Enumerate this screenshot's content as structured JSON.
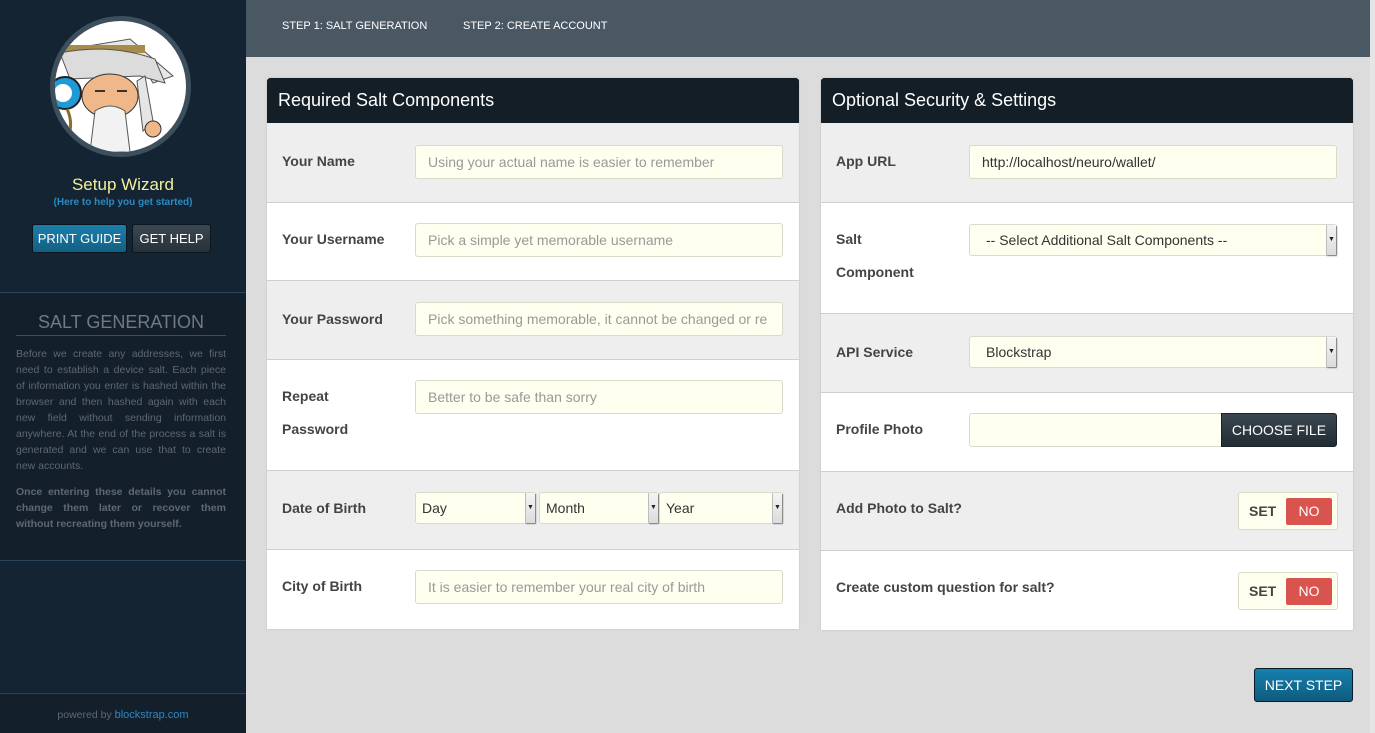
{
  "sidebar": {
    "avatar_alt": "wizard-mascot",
    "title": "Setup Wizard",
    "subtitle": "(Here to help you get started)",
    "print_button": "PRINT GUIDE",
    "help_button": "GET HELP",
    "section_heading": "SALT GENERATION",
    "section_text": "Before we create any addresses, we first need to establish a device salt. Each piece of information you enter is hashed within the browser and then hashed again with each new field without sending information anywhere. At the end of the process a salt is generated and we can use that to create new accounts.",
    "section_warning": "Once entering these details you cannot change them later or recover them without recreating them yourself.",
    "footer_prefix": "powered by ",
    "footer_link": "blockstrap.com"
  },
  "nav": {
    "steps": [
      {
        "label": "STEP 1: SALT GENERATION"
      },
      {
        "label": "STEP 2: CREATE ACCOUNT"
      }
    ]
  },
  "required": {
    "title": "Required Salt Components",
    "name": {
      "label": "Your Name",
      "placeholder": "Using your actual name is easier to remember"
    },
    "username": {
      "label": "Your Username",
      "placeholder": "Pick a simple yet memorable username"
    },
    "password": {
      "label": "Your Password",
      "placeholder": "Pick something memorable, it cannot be changed or re"
    },
    "repeat": {
      "label_line1": "Repeat",
      "label_line2": "Password",
      "placeholder": "Better to be safe than sorry"
    },
    "dob": {
      "label": "Date of Birth",
      "day": "Day",
      "month": "Month",
      "year": "Year"
    },
    "city": {
      "label": "City of Birth",
      "placeholder": "It is easier to remember your real city of birth"
    }
  },
  "optional": {
    "title": "Optional Security & Settings",
    "app_url": {
      "label": "App URL",
      "value": "http://localhost/neuro/wallet/"
    },
    "salt_component": {
      "label_line1": "Salt",
      "label_line2": "Component",
      "selected": "-- Select Additional Salt Components --"
    },
    "api_service": {
      "label": "API Service",
      "selected": "Blockstrap"
    },
    "profile_photo": {
      "label": "Profile Photo",
      "button": "CHOOSE FILE"
    },
    "add_photo": {
      "label": "Add Photo to Salt?",
      "set": "SET",
      "state": "NO"
    },
    "custom_question": {
      "label": "Create custom question for salt?",
      "set": "SET",
      "state": "NO"
    }
  },
  "next_button": "NEXT STEP",
  "colors": {
    "accent": "#1580ad",
    "toggle_no": "#d9534f",
    "sidebar_title": "#f3ef9c",
    "input_bg": "#fffff0"
  }
}
